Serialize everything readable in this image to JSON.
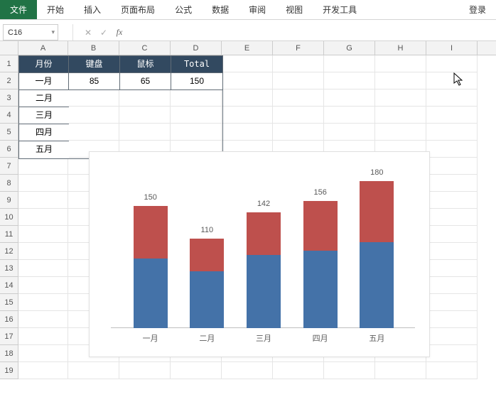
{
  "ribbon": {
    "tabs": [
      "文件",
      "开始",
      "插入",
      "页面布局",
      "公式",
      "数据",
      "审阅",
      "视图",
      "开发工具"
    ],
    "active_index": 0,
    "login": "登录"
  },
  "formula_bar": {
    "name_box": "C16",
    "cancel": "✕",
    "confirm": "✓",
    "fx": "fx",
    "formula": ""
  },
  "columns": [
    "A",
    "B",
    "C",
    "D",
    "E",
    "F",
    "G",
    "H",
    "I"
  ],
  "row_count": 19,
  "table": {
    "headers": [
      "月份",
      "键盘",
      "鼠标",
      "Total"
    ],
    "rows": [
      [
        "一月",
        "85",
        "65",
        "150"
      ],
      [
        "二月",
        "",
        "",
        ""
      ],
      [
        "三月",
        "",
        "",
        ""
      ],
      [
        "四月",
        "",
        "",
        ""
      ],
      [
        "五月",
        "",
        "",
        ""
      ]
    ]
  },
  "chart_data": {
    "type": "bar",
    "stacked": true,
    "categories": [
      "一月",
      "二月",
      "三月",
      "四月",
      "五月"
    ],
    "series": [
      {
        "name": "键盘",
        "color": "#4472a8",
        "values": [
          85,
          70,
          90,
          95,
          105
        ]
      },
      {
        "name": "鼠标",
        "color": "#be504d",
        "values": [
          65,
          40,
          52,
          61,
          75
        ]
      }
    ],
    "totals": [
      150,
      110,
      142,
      156,
      180
    ],
    "ylim": [
      0,
      200
    ]
  },
  "cursor_glyph": "↖"
}
